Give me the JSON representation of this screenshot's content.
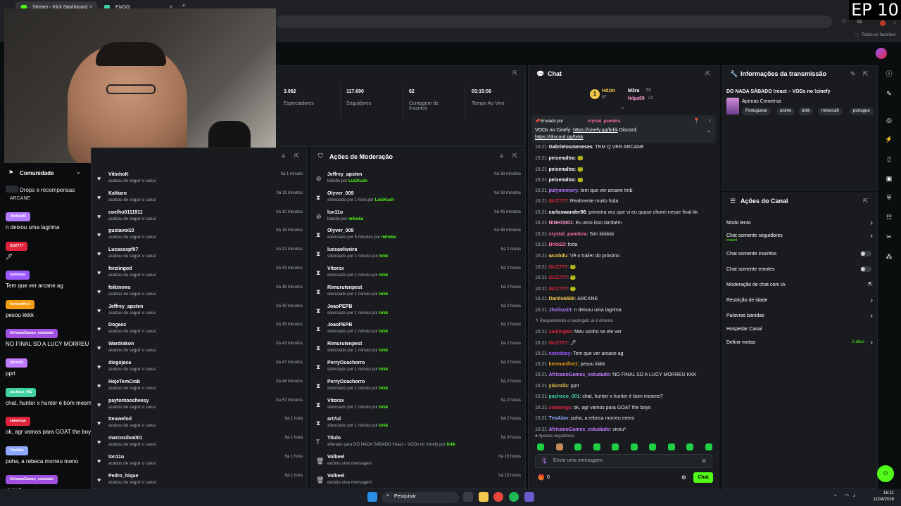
{
  "browser": {
    "tabs": [
      {
        "label": "Stream - Kick Dashboard",
        "icon": "kick-icon"
      },
      {
        "label": "PixGG",
        "icon": "pixgg-icon"
      }
    ],
    "bookmarks_label": "Todos os favoritos"
  },
  "episode_badge": "EP 10",
  "stats": [
    {
      "value": "3.062",
      "label": "Espectadores"
    },
    {
      "value": "117.690",
      "label": "Seguidores"
    },
    {
      "value": "62",
      "label": "Contagem de Inscritos"
    },
    {
      "value": "03:15:56",
      "label": "Tempo Ao Vivo"
    }
  ],
  "community": {
    "title": "Comunidade",
    "drops_label": "Drops e recompensas",
    "arcane_label": "ARCANE"
  },
  "overlay_chat": [
    {
      "user": "Jholiso23",
      "color": "#b57bff",
      "msg": "n deixou uma lagrima"
    },
    {
      "user": "GUZ777",
      "color": "#e0243c",
      "msg": "🖊"
    },
    {
      "user": "notedaay",
      "color": "#9b59ff",
      "msg": "Tem que ver arcane ag"
    },
    {
      "user": "kevinonfire1",
      "color": "#f29c11",
      "msg": "pesou kkkk"
    },
    {
      "user": "AfricanoGames_estudado",
      "color": "#a04fe0",
      "msg": "NO FINAL SO A LUCY MORREU KKK"
    },
    {
      "user": "yScrollx",
      "color": "#c27bff",
      "msg": "pprt"
    },
    {
      "user": "pacheco_001",
      "color": "#3fd1a0",
      "msg": "chat, hunter x hunter é bom mesmo?"
    },
    {
      "user": "sakavega",
      "color": "#e0243c",
      "msg": "ok, agr vamos para GOAT the boys"
    },
    {
      "user": "TnsAlan",
      "color": "#8ea8ff",
      "msg": "poha, a rebeca morreu meno"
    },
    {
      "user": "AfricanoGames_estudado",
      "color": "#a04fe0",
      "msg": "viveu*"
    }
  ],
  "followers": [
    {
      "name": "VitinhoK",
      "sub": "acabou de seguir o canal",
      "time": "há 1 minuto"
    },
    {
      "name": "Kaltiaro",
      "sub": "acabou de seguir o canal",
      "time": "há 11 minutos"
    },
    {
      "name": "coelho0111911",
      "sub": "acabou de seguir o canal",
      "time": "há 10 minutos"
    },
    {
      "name": "gustavoi10",
      "sub": "acabou de seguir o canal",
      "time": "há 18 minutos"
    },
    {
      "name": "Lucasxxpf07",
      "sub": "acabou de seguir o canal",
      "time": "há 22 minutos"
    },
    {
      "name": "ferziingod",
      "sub": "acabou de seguir o canal",
      "time": "há 33 minutos"
    },
    {
      "name": "feikinews",
      "sub": "acabou de seguir o canal",
      "time": "há 36 minutos"
    },
    {
      "name": "Jeffrey_apsten",
      "sub": "acabou de seguir o canal",
      "time": "há 39 minutos"
    },
    {
      "name": "Dogaoz",
      "sub": "acabou de seguir o canal",
      "time": "há 39 minutos"
    },
    {
      "name": "Wardrakon",
      "sub": "acabou de seguir o canal",
      "time": "há 43 minutos"
    },
    {
      "name": "diegojaca",
      "sub": "acabou de seguir o canal",
      "time": "há 47 minutos"
    },
    {
      "name": "HojeTemCrab",
      "sub": "acabou de seguir o canal",
      "time": "há 48 minutos"
    },
    {
      "name": "paytontoocheesy",
      "sub": "acabou de seguir o canal",
      "time": "há 57 minutos"
    },
    {
      "name": "tteuwefod",
      "sub": "acabou de seguir o canal",
      "time": "há 1 hora"
    },
    {
      "name": "marcosilva001",
      "sub": "acabou de seguir o canal",
      "time": "há 1 hora"
    },
    {
      "name": "lon11u",
      "sub": "acabou de seguir o canal",
      "time": "há 1 hora"
    },
    {
      "name": "Pedro_hique",
      "sub": "acabou de seguir o canal",
      "time": "há 1 hora"
    }
  ],
  "moderation": {
    "title": "Ações de Moderação",
    "items": [
      {
        "icon": "⊘",
        "name": "Jeffrey_apsten",
        "sub": "banido por ",
        "by": "LuizKush",
        "time": "há 38 minutos"
      },
      {
        "icon": "⧗",
        "name": "Olyver_009",
        "sub": "silenciado por 1 hora por ",
        "by": "LuizKush",
        "time": "há 38 minutos"
      },
      {
        "icon": "⊘",
        "name": "lon11u",
        "sub": "banido por ",
        "by": "mihoku",
        "time": "há 45 minutos"
      },
      {
        "icon": "⧗",
        "name": "Olyver_009",
        "sub": "silenciado por 5 minutos por ",
        "by": "mihoku",
        "time": "há 48 minutos"
      },
      {
        "icon": "⧗",
        "name": "luccaoliveira",
        "sub": "silenciado por 1 minuto por ",
        "by": "brkk",
        "time": "há 2 horas"
      },
      {
        "icon": "⧗",
        "name": "Vitorsx",
        "sub": "silenciado por 1 minuto por ",
        "by": "brkk",
        "time": "há 2 horas"
      },
      {
        "icon": "⧗",
        "name": "Rimurutenpest",
        "sub": "silenciado por 1 minuto por ",
        "by": "brkk",
        "time": "há 2 horas"
      },
      {
        "icon": "⧗",
        "name": "JoaoPEPB",
        "sub": "silenciado por 1 minuto por ",
        "by": "brkk",
        "time": "há 2 horas"
      },
      {
        "icon": "⧗",
        "name": "JoaoPEPB",
        "sub": "silenciado por 1 minuto por ",
        "by": "brkk",
        "time": "há 2 horas"
      },
      {
        "icon": "⧗",
        "name": "Rimurutenpest",
        "sub": "silenciado por 1 minuto por ",
        "by": "brkk",
        "time": "há 2 horas"
      },
      {
        "icon": "⧗",
        "name": "PerryOcachorro",
        "sub": "silenciado por 1 minuto por ",
        "by": "brkk",
        "time": "há 2 horas"
      },
      {
        "icon": "⧗",
        "name": "PerryOcachorro",
        "sub": "silenciado por 1 minuto por ",
        "by": "brkk",
        "time": "há 2 horas"
      },
      {
        "icon": "⧗",
        "name": "Vitorsx",
        "sub": "silenciado por 1 minuto por ",
        "by": "brkk",
        "time": "há 2 horas"
      },
      {
        "icon": "⧗",
        "name": "art7ul",
        "sub": "silenciado por 1 minuto por ",
        "by": "brkk",
        "time": "há 2 horas"
      },
      {
        "icon": "T",
        "name": "Título",
        "sub": "alterado para DO NADA SÁBADO !react – VODs no !cinefy por ",
        "by": "brkk",
        "time": "há 3 horas"
      },
      {
        "icon": "🗑",
        "name": "Volbeel",
        "sub": "excluiu uma mensagem",
        "by": "",
        "time": "há 15 horas"
      },
      {
        "icon": "🗑",
        "name": "Volbeel",
        "sub": "excluiu uma mensagem",
        "by": "",
        "time": "há 15 horas"
      }
    ]
  },
  "chat": {
    "title": "Chat",
    "top": {
      "rank1": "Hdzin",
      "rank1_score": "57",
      "rank2": "M3ra",
      "rank2_score": "50",
      "rank3": "felpz09",
      "rank3_score": "21"
    },
    "pinned": {
      "label": "Enviado por",
      "user": "crystal_pandora",
      "text": "VODs no Cinefy: ",
      "link1": "https://cinefy.gg/brkk",
      "text2": " Discord: ",
      "link2": "https://discord.gg/brkk"
    },
    "lines": [
      {
        "t": "16:21",
        "user": "Gabrielosmeneses",
        "color": "#ffffff",
        "msg": ": TEM Q VER ARCANE"
      },
      {
        "t": "16:21",
        "user": "peixenaltra",
        "color": "#ffffff",
        "msg": ": 🐸"
      },
      {
        "t": "16:21",
        "user": "peixenaltra",
        "color": "#ffffff",
        "msg": ": 🐸"
      },
      {
        "t": "16:21",
        "user": "peixenaltra",
        "color": "#ffffff",
        "msg": ": 🐸"
      },
      {
        "t": "16:21",
        "user": "jadymemory",
        "color": "#b57bff",
        "msg": ": tem que ver arcane tmb"
      },
      {
        "t": "16:21",
        "user": "GUZ777",
        "color": "#e0243c",
        "msg": ": Realmente muito foda"
      },
      {
        "t": "16:21",
        "user": "carloswander96",
        "color": "#ffffff",
        "msg": ": primeira vez que vi eu quase chorei nesse final kk"
      },
      {
        "t": "16:21",
        "user": "NINHO001",
        "color": "#ff9bd1",
        "msg": ": Eu amo isso também"
      },
      {
        "t": "16:21",
        "user": "crystal_pandora",
        "color": "#ff6fae",
        "msg": ": Sim kkkkkk"
      },
      {
        "t": "16:21",
        "user": "Brkk22",
        "color": "#ff6fae",
        "msg": ": foda"
      },
      {
        "t": "16:21",
        "user": "wuxbdu",
        "color": "#f2c94c",
        "msg": ": Vê o trailer do próximo"
      },
      {
        "t": "16:21",
        "user": "GUZ777",
        "color": "#e0243c",
        "msg": ": 🐸"
      },
      {
        "t": "16:21",
        "user": "GUZ777",
        "color": "#e0243c",
        "msg": ": 🐸"
      },
      {
        "t": "16:21",
        "user": "GUZ777",
        "color": "#e0243c",
        "msg": ": 🐸"
      },
      {
        "t": "16:21",
        "user": "Danilo6666",
        "color": "#f2c94c",
        "msg": ": ARCANE"
      },
      {
        "t": "16:21",
        "user": "Jholiso23",
        "color": "#b57bff",
        "msg": ": n deixou uma lagrima"
      },
      {
        "t": "",
        "user": "",
        "color": "#a7abb0",
        "msg": "↰ Respondendo a xaulingab: ai é cinema"
      },
      {
        "t": "16:21",
        "user": "xaulingab",
        "color": "#e0243c",
        "msg": ": Meu sonho se ele ver"
      },
      {
        "t": "16:21",
        "user": "GUZ777",
        "color": "#e0243c",
        "msg": ": 🖊"
      },
      {
        "t": "16:21",
        "user": "notedaay",
        "color": "#9b59ff",
        "msg": ": Tem que ver arcane ag"
      },
      {
        "t": "16:21",
        "user": "kevinonfire1",
        "color": "#f29c11",
        "msg": ": pesou kkkk"
      },
      {
        "t": "16:21",
        "user": "AfricanoGames_estudado",
        "color": "#c27bff",
        "msg": ": NO FINAL SO A LUCY MORREU KKK"
      },
      {
        "t": "16:21",
        "user": "yScrollx",
        "color": "#f2c94c",
        "msg": ": pprt"
      },
      {
        "t": "16:21",
        "user": "pacheco_001",
        "color": "#3fd1a0",
        "msg": ": chat, hunter x hunter é bom mesmo?"
      },
      {
        "t": "16:21",
        "user": "sakavega",
        "color": "#e0243c",
        "msg": ": ok, agr vamos para GOAT the boys"
      },
      {
        "t": "16:21",
        "user": "TnsAlan",
        "color": "#8ea8ff",
        "msg": ": poha, a rebeca morreu meno"
      },
      {
        "t": "16:21",
        "user": "AfricanoGames_estudado",
        "color": "#c27bff",
        "msg": ": viveu*"
      }
    ],
    "followers_only": "Apenas seguidores",
    "input_placeholder": "Envie uma mensagem",
    "count": "0",
    "send_label": "Chat"
  },
  "stream_info": {
    "title": "Informações da transmissão",
    "stream_title": "DO NADA SÁBADO !react – VODs no !cinefy",
    "category": "Apenas Conversa",
    "tags": [
      "Portuguese",
      "anime",
      "brkk",
      "minecraft",
      "portugue"
    ]
  },
  "channel_actions": {
    "title": "Ações do Canal",
    "items": [
      {
        "label": "Modo lento",
        "sub": "",
        "control": "chevron"
      },
      {
        "label": "Chat somente seguidores",
        "sub": "Instant",
        "control": "chevron"
      },
      {
        "label": "Chat somente inscritos",
        "sub": "",
        "control": "toggle"
      },
      {
        "label": "Chat somente emotes",
        "sub": "",
        "control": "toggle"
      },
      {
        "label": "Moderação de chat com IA",
        "sub": "",
        "control": "external"
      },
      {
        "label": "Restrição de idade",
        "sub": "",
        "control": "chevron"
      },
      {
        "label": "Palavras banidas",
        "sub": "",
        "control": "chevron"
      },
      {
        "label": "Hospedar Canal",
        "sub": "",
        "control": "none"
      },
      {
        "label": "Definir metas",
        "sub": "",
        "control": "chevron",
        "extra": "2 ativo"
      }
    ]
  },
  "taskbar": {
    "search_label": "Pesquisar",
    "time": "16:21",
    "date": "11/04/2026"
  },
  "colors": {
    "accent": "#53fc18",
    "panel": "#191b1f",
    "background": "#0b0e0f"
  }
}
